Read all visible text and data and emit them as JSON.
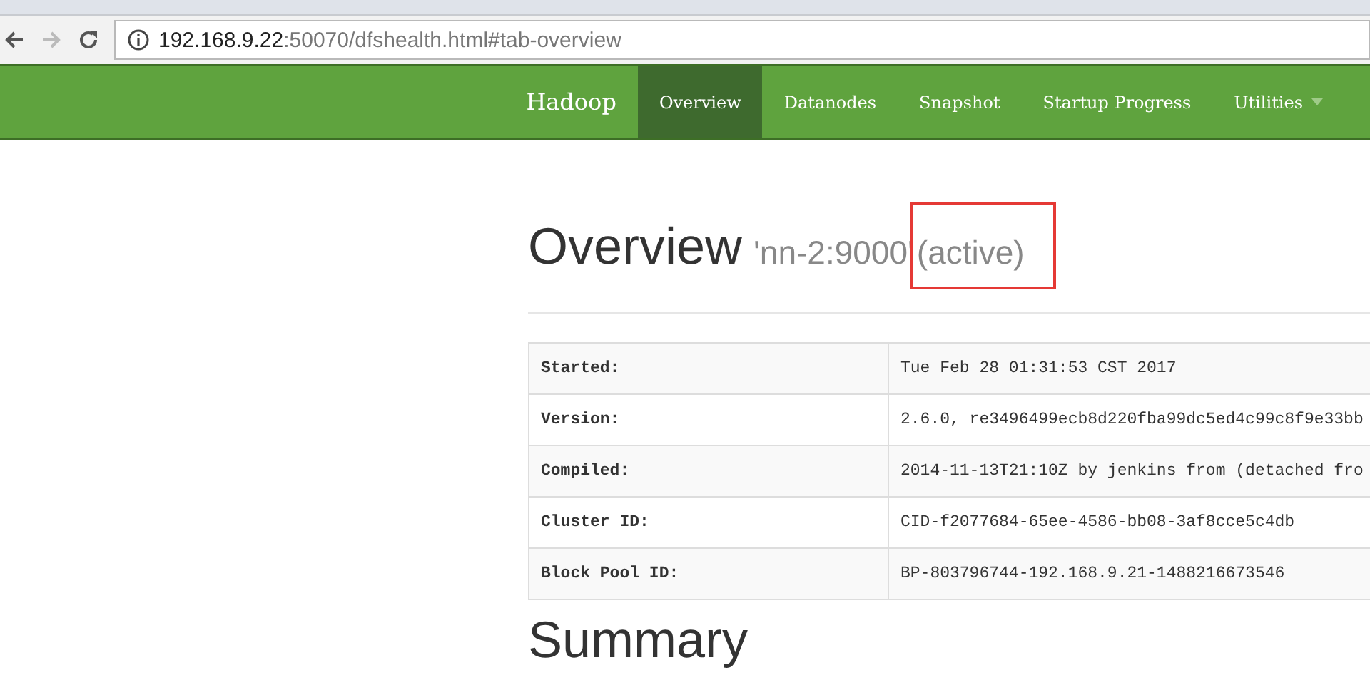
{
  "browser": {
    "url_host": "192.168.9.22",
    "url_rest": ":50070/dfshealth.html#tab-overview"
  },
  "navbar": {
    "brand": "Hadoop",
    "items": [
      {
        "label": "Overview",
        "selected": true,
        "dropdown": false
      },
      {
        "label": "Datanodes",
        "selected": false,
        "dropdown": false
      },
      {
        "label": "Snapshot",
        "selected": false,
        "dropdown": false
      },
      {
        "label": "Startup Progress",
        "selected": false,
        "dropdown": false
      },
      {
        "label": "Utilities",
        "selected": false,
        "dropdown": true
      }
    ]
  },
  "heading": {
    "title": "Overview",
    "subtitle": "'nn-2:9000'",
    "state": "(active)",
    "highlighted": true
  },
  "table": {
    "rows": [
      {
        "label": "Started:",
        "value": "Tue Feb 28 01:31:53 CST 2017"
      },
      {
        "label": "Version:",
        "value": "2.6.0, re3496499ecb8d220fba99dc5ed4c99c8f9e33bb"
      },
      {
        "label": "Compiled:",
        "value": "2014-11-13T21:10Z by jenkins from (detached fro"
      },
      {
        "label": "Cluster ID:",
        "value": "CID-f2077684-65ee-4586-bb08-3af8cce5c4db"
      },
      {
        "label": "Block Pool ID:",
        "value": "BP-803796744-192.168.9.21-1488216673546"
      }
    ]
  },
  "next_heading": "Summary"
}
